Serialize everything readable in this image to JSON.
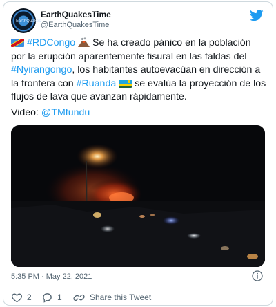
{
  "author": {
    "display_name": "EarthQuakesTime",
    "handle": "@EarthQuakesTime",
    "avatar_text": "EarthQuakes"
  },
  "tweet": {
    "hashtag_drc": "#RDCongo",
    "text_1": " Se ha creado pánico en la población por la erupción aparentemente fisural en las faldas del ",
    "hashtag_nyira": "#Nyirangongo",
    "text_2": ", los habitantes autoevacúan en dirección a la frontera con ",
    "hashtag_rwanda": "#Ruanda",
    "text_3": " se evalúa la proyección de los flujos de lava que avanzan rápidamente.",
    "video_prefix": "Video: ",
    "video_mention": "@TMfundu"
  },
  "timestamp": "5:35 PM · May 22, 2021",
  "actions": {
    "likes": "2",
    "replies": "1",
    "share_label": "Share this Tweet"
  },
  "icons": {
    "brand": "twitter-bird-icon",
    "info": "info-icon",
    "like": "heart-icon",
    "reply": "reply-bubble-icon",
    "share": "share-icon"
  },
  "colors": {
    "accent": "#1d9bf0",
    "text": "#0f1419",
    "muted": "#536471",
    "border": "#cfd9de"
  }
}
